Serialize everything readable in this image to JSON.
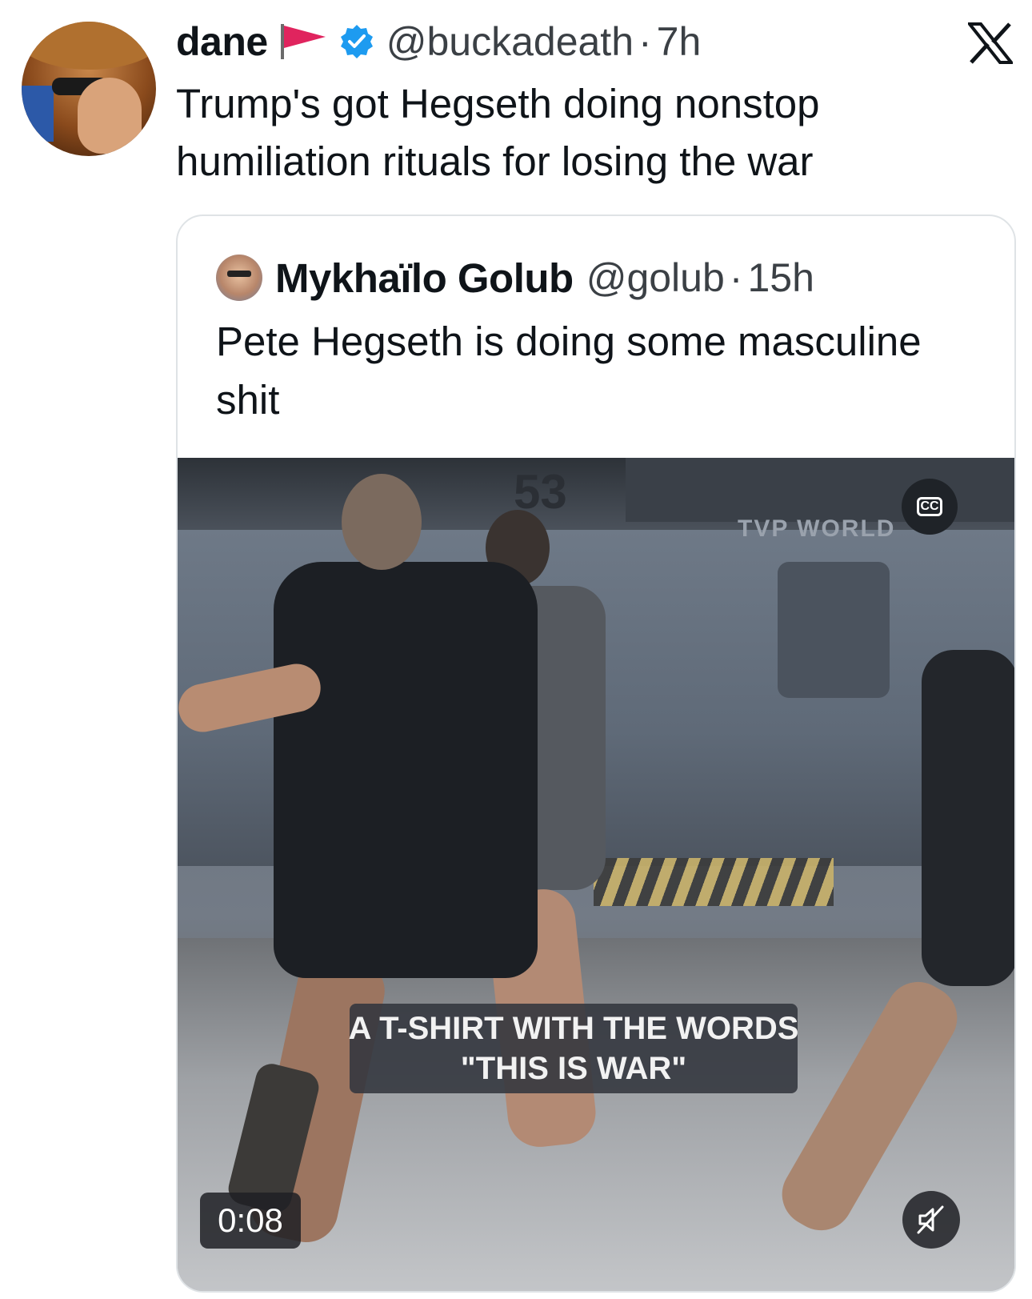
{
  "tweet": {
    "author_name": "dane",
    "author_handle": "@buckadeath",
    "time": "7h",
    "separator": "·",
    "text": "Trump's got Hegseth doing nonstop humiliation rituals for losing the war",
    "verified": true,
    "flag_icon": "red-flag-icon",
    "platform_logo": "x-logo"
  },
  "quoted_tweet": {
    "author_name": "Mykhaïlo Golub",
    "author_handle": "@golub",
    "time": "15h",
    "separator": "·",
    "text": "Pete Hegseth is doing some masculine shit"
  },
  "video": {
    "watermark": "TVP WORLD",
    "caption_line1": "A T-SHIRT WITH THE WORDS",
    "caption_line2": "\"THIS IS WAR\"",
    "timestamp": "0:08",
    "cc_label": "CC",
    "muted": true
  },
  "colors": {
    "verified_blue": "#1d9bf0",
    "flag_red": "#e0245e",
    "text_primary": "#0f1419",
    "text_secondary": "#3b4045",
    "border": "#dfe3e6"
  }
}
